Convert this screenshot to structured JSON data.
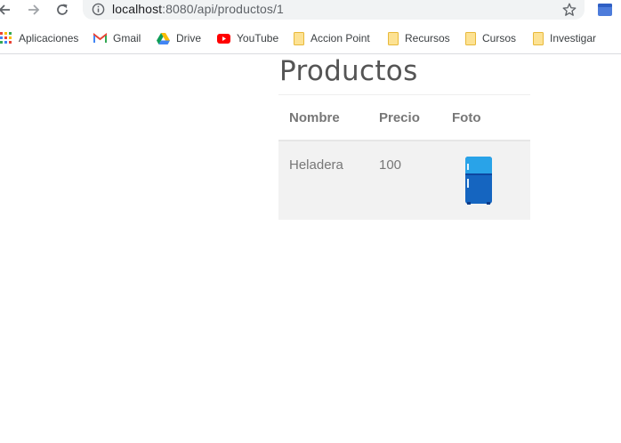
{
  "browser": {
    "url_host": "localhost",
    "url_path": ":8080/api/productos/1",
    "back_icon": "arrow-left-icon",
    "forward_icon": "arrow-right-icon",
    "reload_icon": "reload-icon",
    "info_icon": "info-icon",
    "star_icon": "star-icon",
    "extension_icon": "extension-icon"
  },
  "bookmarks": [
    {
      "label": "Aplicaciones",
      "icon": "apps-grid-icon"
    },
    {
      "label": "Gmail",
      "icon": "gmail-icon"
    },
    {
      "label": "Drive",
      "icon": "drive-icon"
    },
    {
      "label": "YouTube",
      "icon": "youtube-icon"
    },
    {
      "label": "Accion Point",
      "icon": "folder-icon"
    },
    {
      "label": "Recursos",
      "icon": "folder-icon"
    },
    {
      "label": "Cursos",
      "icon": "folder-icon"
    },
    {
      "label": "Investigar",
      "icon": "folder-icon"
    }
  ],
  "page": {
    "title": "Productos",
    "table": {
      "headers": [
        "Nombre",
        "Precio",
        "Foto"
      ],
      "rows": [
        {
          "nombre": "Heladera",
          "precio": "100",
          "foto_icon": "refrigerator-icon"
        }
      ]
    }
  },
  "colors": {
    "table_row_bg": "#f2f2f2",
    "text": "#777777",
    "title": "#555555",
    "omnibox_bg": "#f1f3f4",
    "folder": "#fdd663",
    "fridge_blue": "#1565c0"
  }
}
